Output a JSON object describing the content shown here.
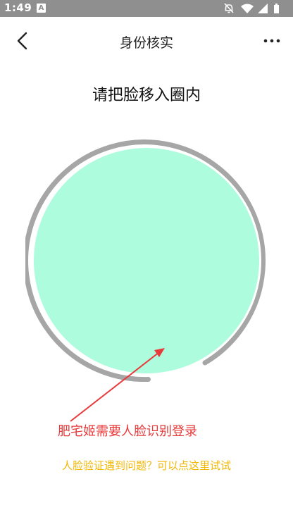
{
  "status_bar": {
    "time": "1:49",
    "app_indicator": "A",
    "icons": [
      "notifications-off-icon",
      "wifi-icon",
      "signal-icon",
      "battery-icon"
    ]
  },
  "header": {
    "title": "身份核实",
    "back_icon": "chevron-left-icon",
    "more_icon": "more-horizontal-icon"
  },
  "main": {
    "instruction": "请把脸移入圈内",
    "face_circle_color": "#adfcde",
    "ring_color": "#a6a6a6",
    "annotation": "肥宅姬需要人脸识别登录",
    "annotation_color": "#e83a3a",
    "help_link": "人脸验证遇到问题？可以点这里试试",
    "help_color": "#f2b705"
  }
}
